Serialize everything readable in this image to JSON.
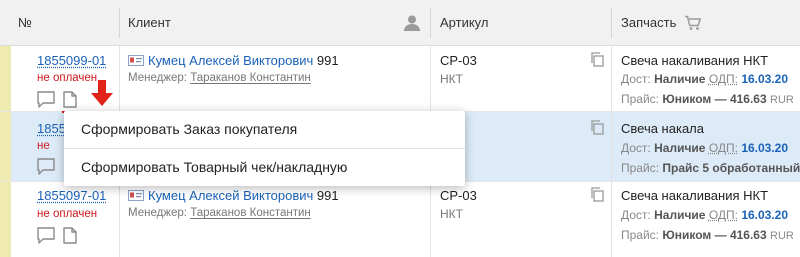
{
  "header": {
    "col_no": "№",
    "col_client": "Клиент",
    "col_article": "Артикул",
    "col_part": "Запчасть",
    "icons": [
      "user-icon",
      "cart-icon"
    ]
  },
  "rows": [
    {
      "order_no": "1855099-01",
      "status": "не оплачен",
      "client_name": "Кумец Алексей Викторович",
      "client_num": "991",
      "manager_label": "Менеджер:",
      "manager_name": "Тараканов Константин",
      "article": "CP-03",
      "brand": "НКТ",
      "part_name": "Свеча накаливания НКТ",
      "avail_label": "Дост:",
      "avail_value": "Наличие",
      "odp_label": "ОДП:",
      "odp_date": "16.03.20",
      "price_label": "Прайс:",
      "price_source": "Юником",
      "price_value": "— 416.63",
      "currency": "RUR"
    },
    {
      "order_no": "1855",
      "status": "не",
      "article": "3",
      "part_name": "Свеча накала",
      "avail_label": "Дост:",
      "avail_value": "Наличие",
      "odp_label": "ОДП:",
      "odp_date": "16.03.20",
      "price_label": "Прайс:",
      "price_source": "Прайс 5 обработанный к"
    },
    {
      "order_no": "1855097-01",
      "status": "не оплачен",
      "client_name": "Кумец Алексей Викторович",
      "client_num": "991",
      "manager_label": "Менеджер:",
      "manager_name": "Тараканов Константин",
      "article": "CP-03",
      "brand": "НКТ",
      "part_name": "Свеча накаливания НКТ",
      "avail_label": "Дост:",
      "avail_value": "Наличие",
      "odp_label": "ОДП:",
      "odp_date": "16.03.20",
      "price_label": "Прайс:",
      "price_source": "Юником",
      "price_value": "— 416.63",
      "currency": "RUR"
    }
  ],
  "context_menu": {
    "items": [
      "Сформировать Заказ покупателя",
      "Сформировать Товарный чек/накладную"
    ]
  },
  "colors": {
    "link": "#1a62b8",
    "status_unpaid": "#d0191f",
    "selected_row": "#dcebf7",
    "row_marker": "#efeab0",
    "header_bg": "#f1f1f1"
  }
}
